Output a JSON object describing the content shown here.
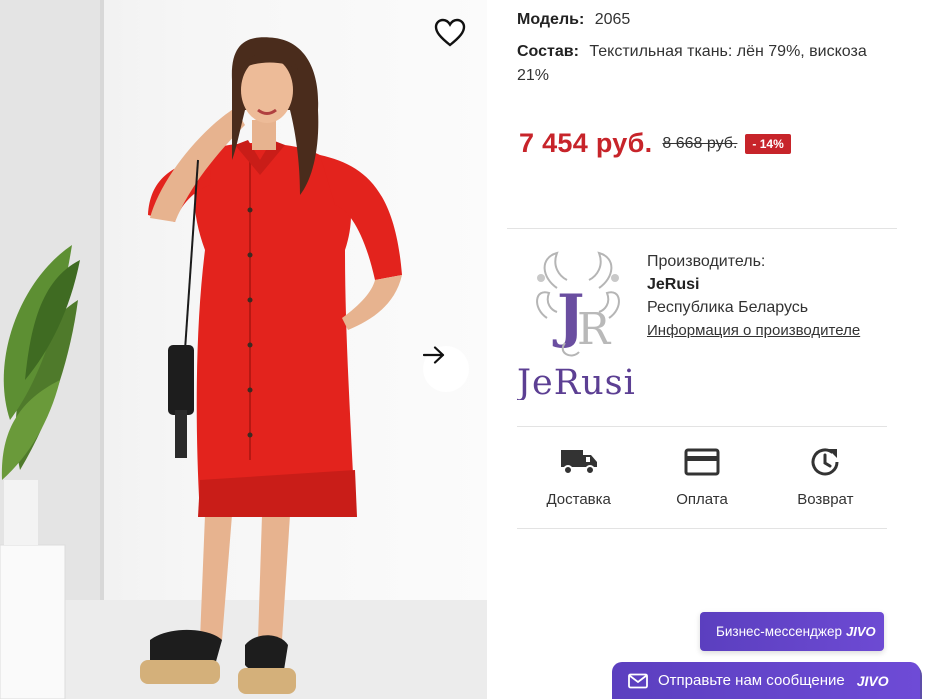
{
  "product": {
    "favorite_icon": "heart-outline-icon",
    "next_icon": "arrow-right-icon"
  },
  "specs": {
    "model_label": "Модель:",
    "model_value": "2065",
    "composition_label": "Состав:",
    "composition_value": "Текстильная ткань: лён 79%, вискоза 21%"
  },
  "price": {
    "current": "7 454 руб.",
    "old": "8 668 руб.",
    "discount": "- 14%",
    "color": "#c7242a"
  },
  "manufacturer": {
    "heading": "Производитель:",
    "brand": "JeRusi",
    "country": "Республика Беларусь",
    "info_link": "Информация о производителе",
    "logo_text": "JeRusi",
    "logo_monogram": "JR"
  },
  "features": [
    {
      "label": "Доставка",
      "icon": "truck-icon"
    },
    {
      "label": "Оплата",
      "icon": "card-icon"
    },
    {
      "label": "Возврат",
      "icon": "return-clock-icon"
    }
  ],
  "chat": {
    "business_label": "Бизнес-мессенджер",
    "jivo": "JIVO",
    "message_label": "Отправьте нам сообщение",
    "accent": "#5b3fbf"
  }
}
